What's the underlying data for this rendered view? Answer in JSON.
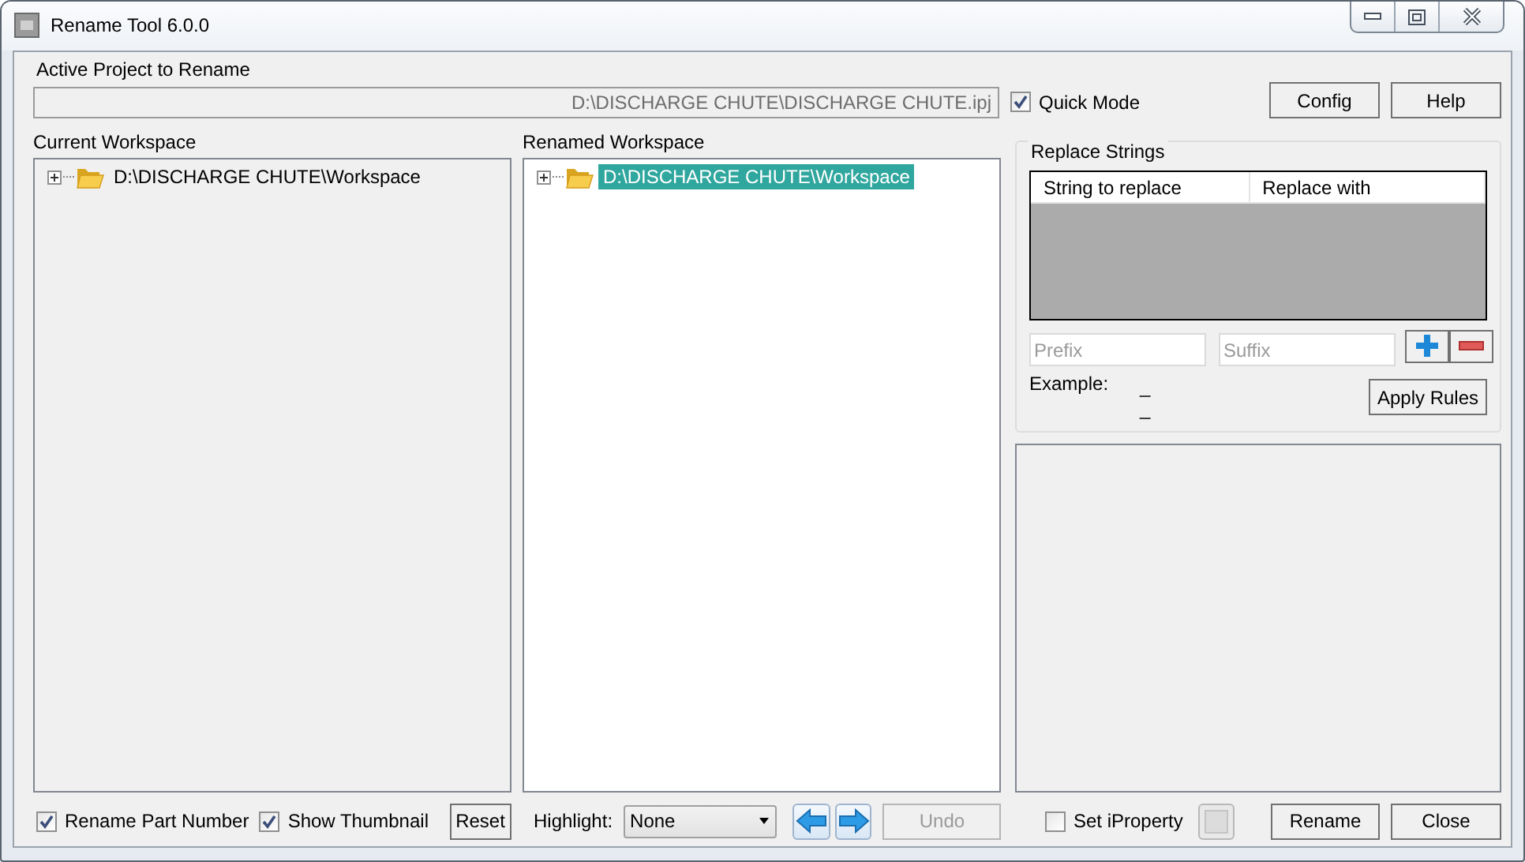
{
  "window": {
    "title": "Rename Tool 6.0.0"
  },
  "active_project": {
    "label": "Active Project to Rename",
    "value": "D:\\DISCHARGE CHUTE\\DISCHARGE CHUTE.ipj"
  },
  "quick_mode": {
    "label": "Quick Mode",
    "checked": true
  },
  "top_buttons": [
    "Config",
    "Help"
  ],
  "current_workspace": {
    "label": "Current Workspace",
    "tree": [
      {
        "label": "D:\\DISCHARGE CHUTE\\Workspace",
        "expanded": false,
        "selected": false
      }
    ]
  },
  "renamed_workspace": {
    "label": "Renamed Workspace",
    "tree": [
      {
        "label": "D:\\DISCHARGE CHUTE\\Workspace",
        "expanded": false,
        "selected": true
      }
    ]
  },
  "replace_strings": {
    "title": "Replace Strings",
    "columns": [
      "String to replace",
      "Replace with"
    ],
    "prefix": {
      "placeholder": "Prefix"
    },
    "suffix": {
      "placeholder": "Suffix"
    },
    "example_label": "Example:",
    "example_lines": [
      "_",
      "_"
    ],
    "apply_button": "Apply Rules"
  },
  "bottom": {
    "rename_part_number": {
      "label": "Rename Part Number",
      "checked": true
    },
    "show_thumbnail": {
      "label": "Show Thumbnail",
      "checked": true
    },
    "reset_button": "Reset",
    "highlight": {
      "label": "Highlight:",
      "value": "None"
    },
    "undo": {
      "label": "Undo",
      "disabled": true
    },
    "set_iproperty": {
      "label": "Set iProperty",
      "checked": false
    },
    "rename_button": "Rename",
    "close_button": "Close"
  }
}
